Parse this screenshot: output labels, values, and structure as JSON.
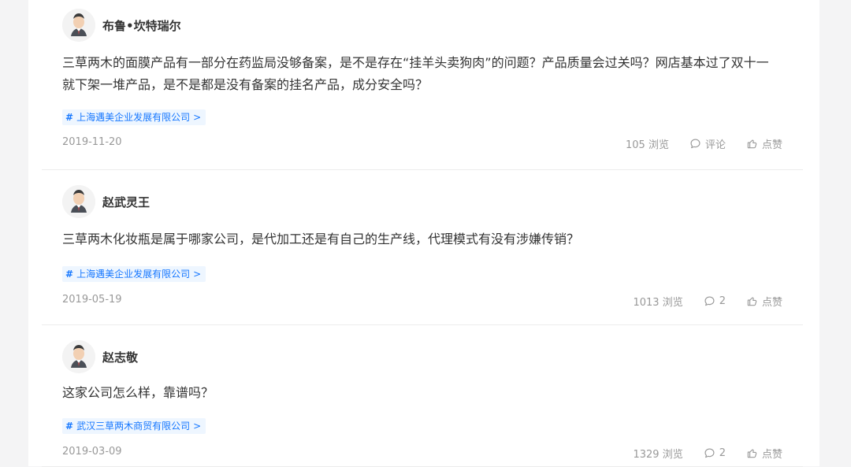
{
  "questions": [
    {
      "user": "布鲁•坎特瑞尔",
      "text": "三草两木的面膜产品有一部分在药监局没够备案，是不是存在“挂羊头卖狗肉”的问题？产品质量会过关吗？网店基本过了双十一就下架一堆产品，是不是都是没有备案的挂名产品，成分安全吗？",
      "company_tag": "上海遇美企业发展有限公司",
      "date": "2019-11-20",
      "views": "105 浏览",
      "comment_label": "评论",
      "like_label": "点赞"
    },
    {
      "user": "赵武灵王",
      "text": "三草两木化妆瓶是属于哪家公司，是代加工还是有自己的生产线，代理模式有没有涉嫌传销？",
      "company_tag": "上海遇美企业发展有限公司",
      "date": "2019-05-19",
      "views": "1013 浏览",
      "comment_label": "2",
      "like_label": "点赞"
    },
    {
      "user": "赵志敬",
      "text": "这家公司怎么样，靠谱吗？",
      "company_tag": "武汉三草两木商贸有限公司",
      "date": "2019-03-09",
      "views": "1329 浏览",
      "comment_label": "2",
      "like_label": "点赞"
    }
  ],
  "icons": {
    "hash": "#",
    "arrow": ">",
    "comment": "comment-icon",
    "like": "thumb-up-icon",
    "avatar": "avatar-icon"
  },
  "colors": {
    "page_bg": "#f4f4f5",
    "card_bg": "#ffffff",
    "text_primary": "#333333",
    "text_secondary": "#999999",
    "tag_bg": "#eef6ff",
    "tag_text": "#1677ff"
  }
}
